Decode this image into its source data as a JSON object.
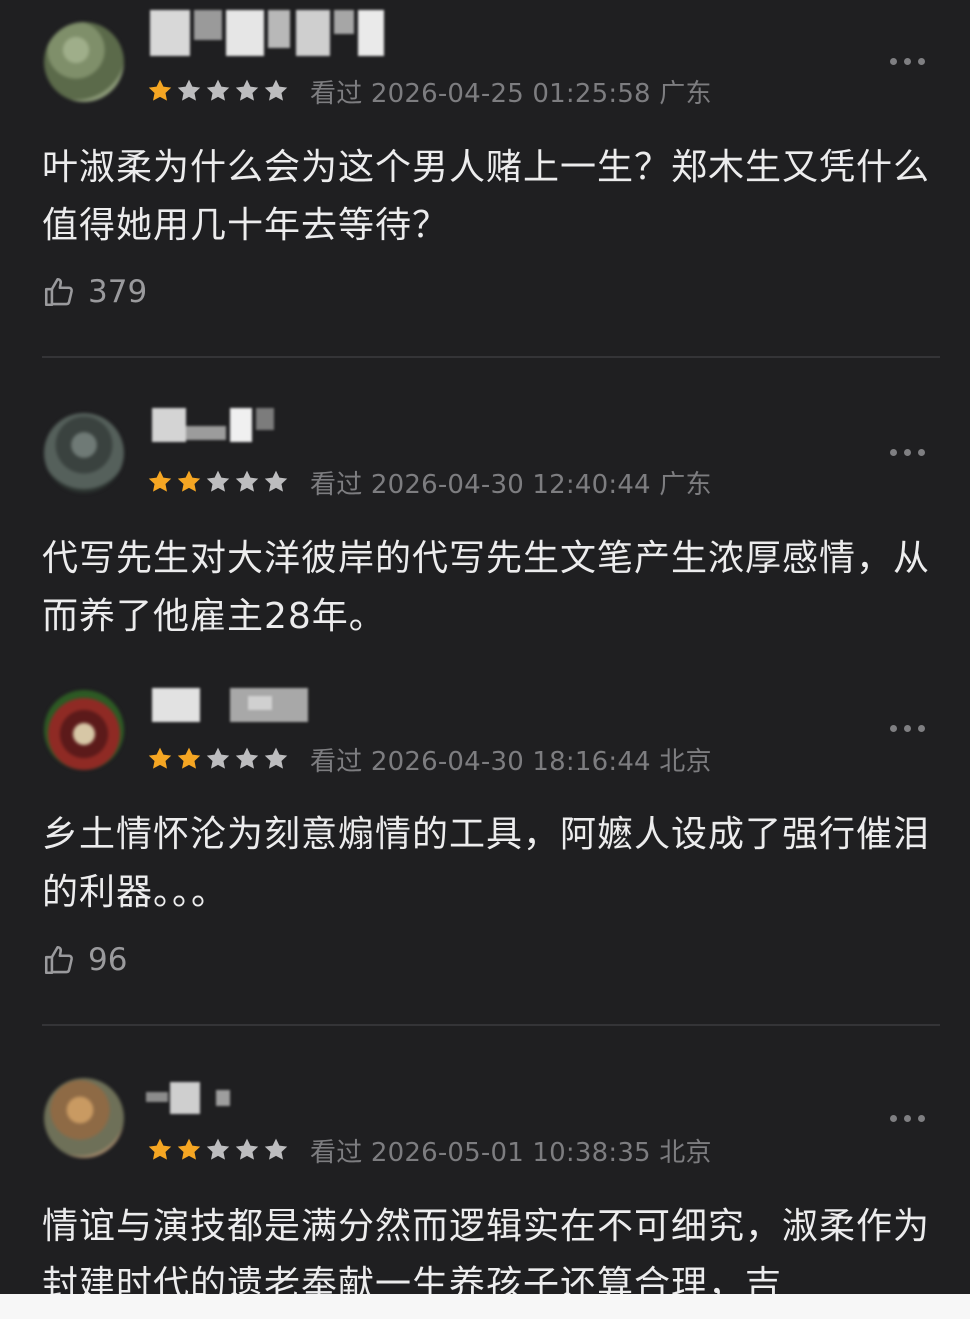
{
  "reviews": [
    {
      "rating": 1,
      "max_rating": 5,
      "meta": "看过  2026-04-25 01:25:58 广东",
      "text": "叶淑柔为什么会为这个男人赌上一生？郑木生又凭什么值得她用几十年去等待？",
      "likes": "379"
    },
    {
      "rating": 2,
      "max_rating": 5,
      "meta": "看过  2026-04-30 12:40:44 广东",
      "text": "代写先生对大洋彼岸的代写先生文笔产生浓厚感情，从而养了他雇主28年。",
      "likes": ""
    },
    {
      "rating": 2,
      "max_rating": 5,
      "meta": "看过  2026-04-30 18:16:44 北京",
      "text": "乡土情怀沦为刻意煽情的工具，阿嬷人设成了强行催泪的利器。。。",
      "likes": "96"
    },
    {
      "rating": 2,
      "max_rating": 5,
      "meta": "看过  2026-05-01 10:38:35 北京",
      "text": "情谊与演技都是满分然而逻辑实在不可细究，淑柔作为封建时代的遗老奉献一生养孩子还算合理，吉",
      "likes": ""
    }
  ],
  "icons": {
    "star_filled": "star-filled-icon",
    "star_empty": "star-empty-icon",
    "more": "more-dots-icon",
    "like": "thumbs-up-icon"
  },
  "colors": {
    "background": "#1f1f21",
    "star_filled": "#f5a623",
    "star_empty": "#bdbdbf",
    "meta_text": "#7d7d80",
    "body_text": "#ececed"
  }
}
